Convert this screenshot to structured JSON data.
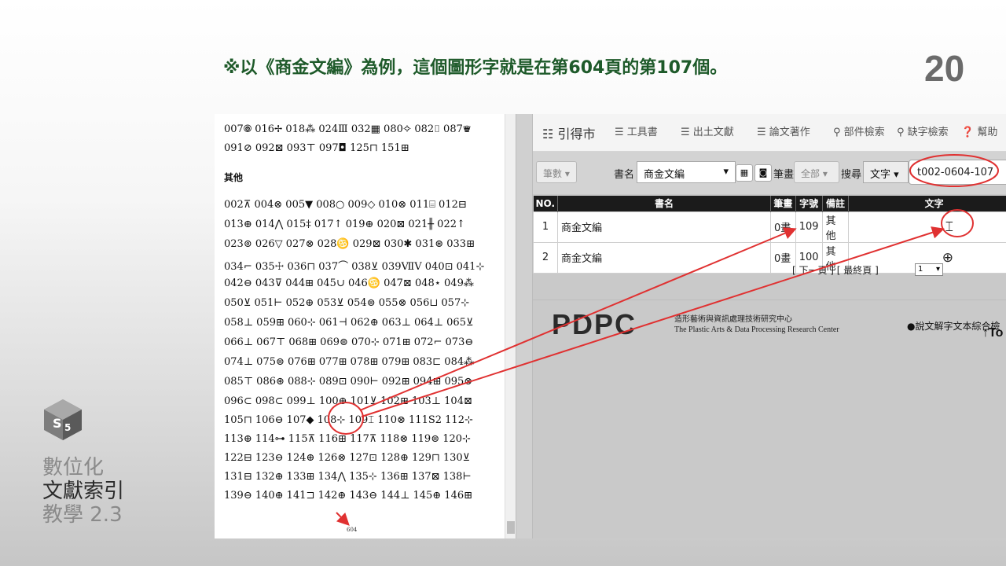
{
  "slide": {
    "title": "※以《商金文編》為例，這個圖形字就是在第604頁的第107個。",
    "page_number": "20",
    "caption_line1": "數位化",
    "caption_line2": "文獻索引",
    "caption_line3": "教學 2.3"
  },
  "book_page": {
    "rows_top": [
      "007🞋 016✢ 018⁂ 024Ⅲ 032▦ 080✧ 082⌷ 087♛",
      "091⊘ 092⊠ 093⊤ 097◘ 125⊓ 151⊞"
    ],
    "section_title": "其他",
    "rows": [
      "002⊼ 004⊗ 005▼ 008○ 009◇ 010⊗ 011⌸ 012⊟",
      "013⊕ 014⋀ 015‡ 017↑ 019⊕ 020⊠ 021╫ 022↑",
      "023⊚ 026▽ 027⊗ 028♋ 029⊠ 030✱ 031⊛ 033⊞",
      "034⌐ 035☩ 036⊓ 037⌒ 038⊻ 039ⅦⅤ 040⊡ 041⊹",
      "042⊖ 043⊽ 044⊞ 045∪ 046♋ 047⊠ 048⋆ 049⁂",
      "050⊻ 051⊢ 052⊕ 053⊻ 054⊜ 055⊗ 056⊔ 057⊹",
      "058⊥ 059⊞ 060⊹ 061⊣ 062⊕ 063⊥ 064⊥ 065⊻",
      "066⊥ 067⊤ 068⊞ 069⊜ 070⊹ 071⊞ 072⌐ 073⊖",
      "074⊥ 075⊜ 076⊞ 077⊞ 078⊞ 079⊞ 083⊏ 084⁂",
      "085⊤ 086⊛ 088⊹ 089⊡ 090⊢ 092⊞ 094⊞ 095⊗",
      "096⊂ 098⊂ 099⊥ 100⊕ 101⊻ 102⊞ 103⊥ 104⊠",
      "105⊓ 106⊖ 107◆ 108⊹ 109⌶ 110⊗ 111S2 112⊹",
      "113⊕ 114⊶ 115⊼ 116⊞ 117⊼ 118⊗ 119⊜ 120⊹",
      "122⊟ 123⊖ 124⊕ 126⊗ 127⊡ 128⊕ 129⊓ 130⊻",
      "131⊟ 132⊕ 133⊞ 134⋀ 135⊹ 136⊞ 137⊠ 138⊢",
      "139⊖ 140⊕ 141⊐ 142⊕ 143⊖ 144⊥ 145⊕ 146⊞"
    ],
    "footer_page": "604"
  },
  "app": {
    "brand": "引得市",
    "menu": [
      "工具書",
      "出土文獻",
      "論文著作",
      "部件檢索",
      "缺字檢索",
      "幫助"
    ],
    "icons": {
      "brand": "book-stack-icon",
      "menu_list": "list-icon",
      "search": "magnifier-icon",
      "help": "question-circle-icon"
    },
    "search": {
      "stroke_button": "筆數",
      "book_label": "書名",
      "book_value": "商金文編",
      "stroke_label": "筆畫",
      "stroke_value": "全部",
      "search_label": "搜尋",
      "search_type": "文字",
      "query": "t002-0604-107"
    },
    "table": {
      "headers": [
        "NO.",
        "書名",
        "筆畫",
        "字號",
        "備註",
        "文字"
      ],
      "rows": [
        {
          "no": "1",
          "book": "商金文編",
          "strokes": "0畫",
          "num": "109",
          "note": "其他",
          "glyph": "⌶"
        },
        {
          "no": "2",
          "book": "商金文編",
          "strokes": "0畫",
          "num": "100",
          "note": "其他",
          "glyph": "⊕"
        }
      ]
    },
    "pager": {
      "text": "[ 下一頁 ] [ 最終頁 ]",
      "page_value": "1"
    },
    "footer": {
      "logo": "PDPC",
      "org_zh": "造形藝術與資訊處理技術研究中心",
      "org_en": "The Plastic Arts & Data Processing Research Center",
      "link": "●說文解字文本綜合檢",
      "top_button": "To"
    }
  },
  "colors": {
    "title_green": "#1e5a2a",
    "annotation_red": "#e03131",
    "table_header": "#1b1b1b"
  }
}
